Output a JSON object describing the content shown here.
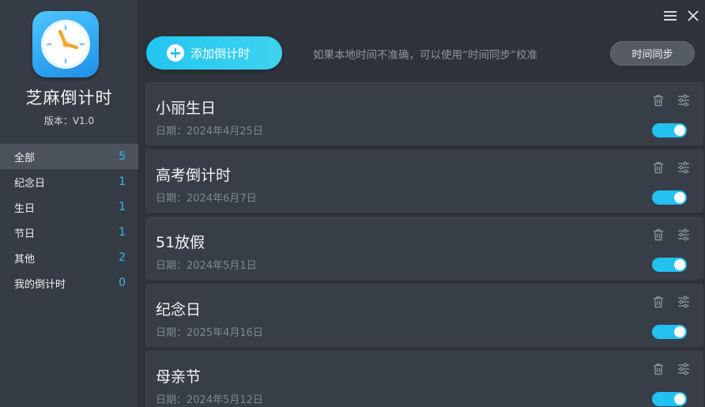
{
  "app": {
    "name": "芝麻倒计时",
    "version": "版本：V1.0",
    "logo_icon": "clock-icon"
  },
  "window": {
    "menu_icon": "menu-icon",
    "close_icon": "close-icon"
  },
  "sidebar": {
    "items": [
      {
        "label": "全部",
        "count": "5",
        "active": true
      },
      {
        "label": "纪念日",
        "count": "1"
      },
      {
        "label": "生日",
        "count": "1"
      },
      {
        "label": "节日",
        "count": "1"
      },
      {
        "label": "其他",
        "count": "2"
      },
      {
        "label": "我的倒计时",
        "count": "0"
      }
    ]
  },
  "toolbar": {
    "add_label": "添加倒计时",
    "hint": "如果本地时间不准确，可以使用“时间同步”校准",
    "sync_label": "时间同步"
  },
  "cards": [
    {
      "title": "小丽生日",
      "date": "日期：2024年4月25日",
      "enabled": true
    },
    {
      "title": "高考倒计时",
      "date": "日期：2024年6月7日",
      "enabled": true
    },
    {
      "title": "51放假",
      "date": "日期：2024年5月1日",
      "enabled": true
    },
    {
      "title": "纪念日",
      "date": "日期：2025年4月16日",
      "enabled": true
    },
    {
      "title": "母亲节",
      "date": "日期：2024年5月12日",
      "enabled": true
    }
  ],
  "colors": {
    "accent": "#22c1ef",
    "background": "#2e333b",
    "sidebar": "#363c45",
    "card": "#383e47",
    "count": "#3ab8f0"
  }
}
